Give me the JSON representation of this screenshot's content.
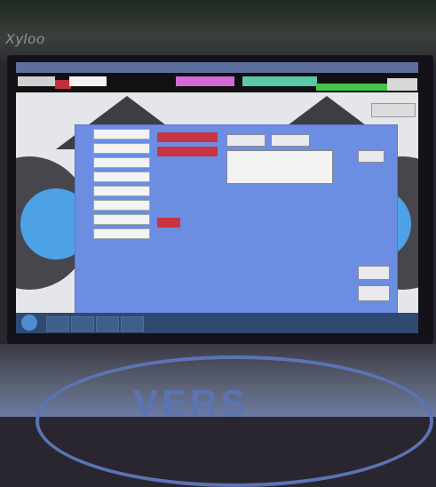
{
  "environment": {
    "brand_text": "Xyloo",
    "desk_logo_text": "VERS"
  },
  "header": {
    "left_label": "",
    "white_label": "",
    "pink_label": "",
    "teal_label": "",
    "green_label": "",
    "right_label": ""
  },
  "dialog": {
    "field_labels": [
      "",
      "",
      "",
      "",
      "",
      "",
      "",
      ""
    ],
    "top_buttons": [
      "",
      ""
    ],
    "side_button": "",
    "bottom_buttons": [
      "",
      ""
    ],
    "list_rows": [
      "",
      "",
      "",
      ""
    ]
  },
  "colors": {
    "dialog_bg": "#6b8ee3",
    "alert_red": "#c8343f",
    "hub_blue": "#4da2e6",
    "taskbar": "#2e4a72"
  }
}
